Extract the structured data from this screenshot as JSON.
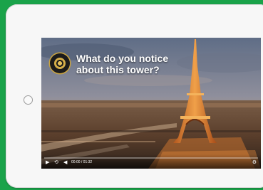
{
  "video": {
    "question_line1": "What do you notice",
    "question_line2": "about this tower?",
    "time_display": "00:00 / 01:32",
    "progress": 0.0
  },
  "icons": {
    "home_button": "home-button",
    "play": "play-icon",
    "skip": "skip-icon",
    "volume": "volume-icon",
    "settings": "gear-icon",
    "logo": "logo-emblem"
  },
  "colors": {
    "background": "#1aa34a",
    "tablet_frame": "#f7f7f7",
    "accent_gold": "#c9a441"
  }
}
